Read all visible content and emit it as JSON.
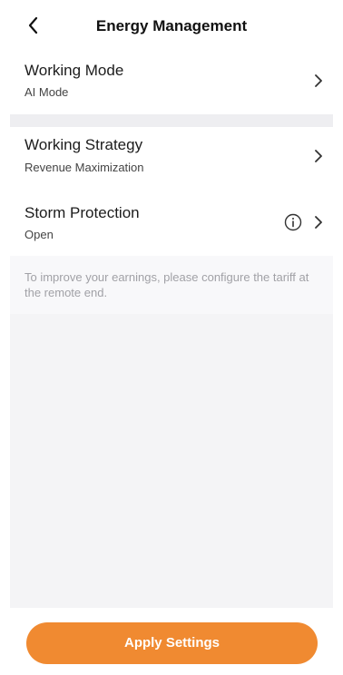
{
  "header": {
    "title": "Energy Management",
    "back_icon": "chevron-left-icon"
  },
  "rows": [
    {
      "label": "Working Mode",
      "value": "AI Mode"
    },
    {
      "label": "Working Strategy",
      "value": "Revenue Maximization"
    },
    {
      "label": "Storm Protection",
      "value": "Open",
      "info_icon": "info-icon"
    }
  ],
  "note": "To improve your earnings, please configure the tariff at the remote end.",
  "apply_button": {
    "label": "Apply Settings",
    "color": "#f08a31"
  }
}
